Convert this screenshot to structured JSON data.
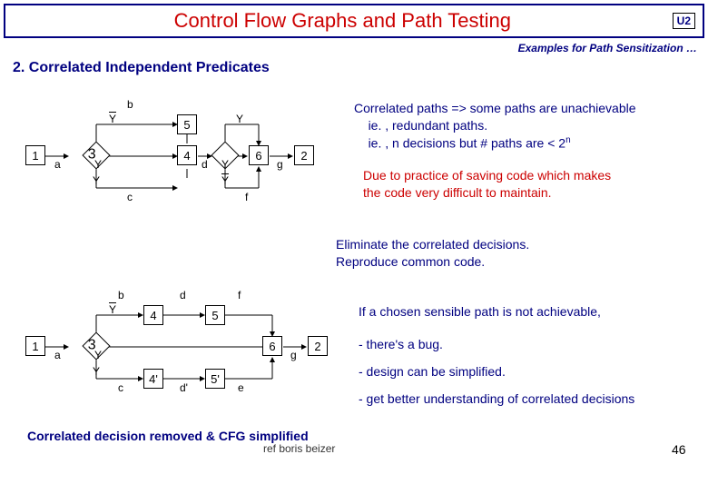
{
  "header": {
    "title": "Control Flow Graphs and Path Testing",
    "unit": "U2"
  },
  "subtitle": "Examples for Path Sensitization …",
  "section": "2. Correlated Independent Predicates",
  "graph1": {
    "nodes": {
      "n1": "1",
      "n3": "3",
      "n4": "4",
      "n5": "5",
      "n6": "6",
      "n2": "2"
    },
    "ylabels": {
      "ybar1": "Y",
      "y1": "Y",
      "y2": "Y",
      "y3": "Y",
      "ybar2": "Y",
      "y4": "Y"
    },
    "edges": {
      "a": "a",
      "b": "b",
      "c": "c",
      "d": "d",
      "f": "f",
      "g": "g"
    }
  },
  "graph2": {
    "nodes": {
      "n1": "1",
      "n3": "3",
      "n4": "4",
      "n4p": "4'",
      "n5": "5",
      "n5p": "5'",
      "n6": "6",
      "n2": "2"
    },
    "ylabels": {
      "ybar1": "Y",
      "y1": "Y",
      "y2": "Y"
    },
    "edges": {
      "a": "a",
      "b": "b",
      "c": "c",
      "d": "d",
      "dp": "d'",
      "e": "e",
      "f": "f",
      "g": "g"
    }
  },
  "rhs": {
    "p1a": "Correlated paths => some paths are unachievable",
    "p1b": "ie. , redundant paths.",
    "p1c_prefix": "ie. , n decisions but  # paths are < 2",
    "p1c_sup": "n",
    "p2a": "Due to practice of saving code which makes",
    "p2b": "the code very difficult to maintain.",
    "p3a": "Eliminate the correlated decisions.",
    "p3b": "Reproduce common code.",
    "p4": "If a chosen sensible path is not achievable,",
    "b1": "- there's a bug.",
    "b2": "- design can be simplified.",
    "b3": "- get better understanding of correlated decisions"
  },
  "footer": {
    "conclusion": "Correlated decision removed & CFG simplified",
    "ref": "ref boris beizer",
    "page": "46"
  }
}
